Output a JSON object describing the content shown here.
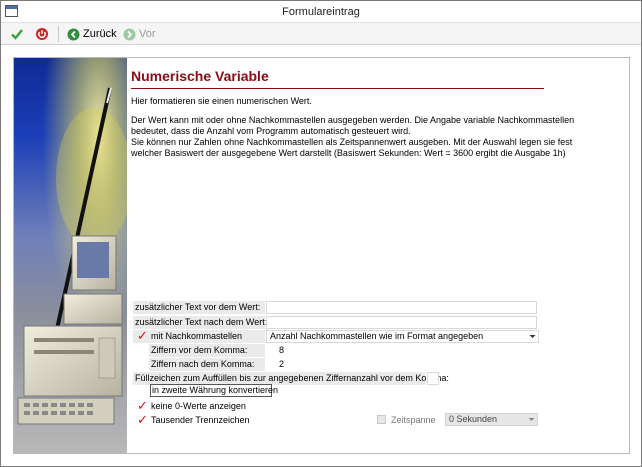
{
  "window": {
    "title": "Formulareintrag"
  },
  "toolbar": {
    "back_label": "Zurück",
    "forward_label": "Vor"
  },
  "page": {
    "heading": "Numerische Variable",
    "intro": "Hier formatieren sie einen numerischen Wert.",
    "desc_lines": [
      "Der Wert kann mit oder ohne Nachkommastellen ausgegeben werden. Die Angabe variable Nachkommastellen",
      "bedeutet, dass die Anzahl vom Programm automatisch gesteuert wird.",
      "Sie können nur Zahlen ohne Nachkommastellen als Zeitspannenwert ausgeben. Mit der Auswahl legen sie fest",
      "welcher Basiswert der ausgegebene Wert darstellt (Basiswert Sekunden: Wert = 3600 ergibt die Ausgabe 1h)"
    ]
  },
  "form": {
    "text_before_label": "zusätzlicher Text vor dem Wert:",
    "text_before_value": "",
    "text_after_label": "zusätzlicher Text nach dem Wert:",
    "text_after_value": "",
    "decimals_label": "mit Nachkommastellen",
    "decimals_checked": true,
    "decimals_select": "Anzahl Nachkommastellen wie im Format angegeben",
    "digits_before_label": "Ziffern vor dem Komma:",
    "digits_before_value": "8",
    "digits_after_label": "Ziffern nach dem Komma:",
    "digits_after_value": "2",
    "fill_label": "Füllzeichen zum Auffüllen bis zur angegebenen Ziffernanzahl vor dem Komma:",
    "fill_value": "",
    "convert_label": "in zweite Währung konvertieren",
    "no_zero_label": "keine 0-Werte anzeigen",
    "no_zero_checked": true,
    "thousand_sep_label": "Tausender Trennzeichen",
    "thousand_sep_checked": true,
    "timespan_label": "Zeitspanne",
    "timespan_checked": false,
    "timespan_select": "0 Sekunden"
  },
  "colors": {
    "heading": "#8b0c14",
    "check": "#dd1111",
    "ok_green": "#3aa43a",
    "cancel_red": "#cc2222"
  },
  "icons": {
    "ok": "checkmark-icon",
    "cancel": "power-icon",
    "back": "back-arrow-icon",
    "forward": "forward-arrow-icon"
  }
}
